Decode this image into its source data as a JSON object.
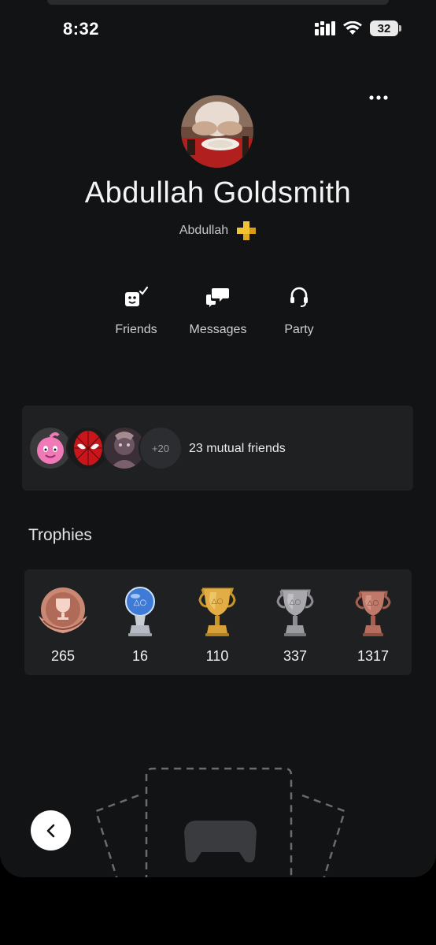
{
  "status_bar": {
    "time": "8:32",
    "battery": "32",
    "icons": [
      "signal-icon",
      "wifi-icon",
      "battery-icon"
    ]
  },
  "header": {
    "more_icon": "more-horizontal-icon"
  },
  "profile": {
    "name": "Abdullah Goldsmith",
    "online_id": "Abdullah",
    "plus_badge": "ps-plus-icon"
  },
  "actions": [
    {
      "label": "Friends",
      "icon": "friends-icon"
    },
    {
      "label": "Messages",
      "icon": "messages-icon"
    },
    {
      "label": "Party",
      "icon": "party-headset-icon"
    }
  ],
  "mutual_friends": {
    "more_count": "+20",
    "text": "23 mutual friends"
  },
  "trophies": {
    "title": "Trophies",
    "items": [
      {
        "type": "trophy-level",
        "count": "265"
      },
      {
        "type": "platinum",
        "count": "16"
      },
      {
        "type": "gold",
        "count": "110"
      },
      {
        "type": "silver",
        "count": "337"
      },
      {
        "type": "bronze",
        "count": "1317"
      }
    ]
  },
  "colors": {
    "background": "#121314",
    "card": "#1f2022",
    "ps_plus": "#f3c230",
    "gold": "#d6a337",
    "silver": "#a9a9ad",
    "bronze": "#c07868",
    "platinum": "#8fb6e6"
  }
}
